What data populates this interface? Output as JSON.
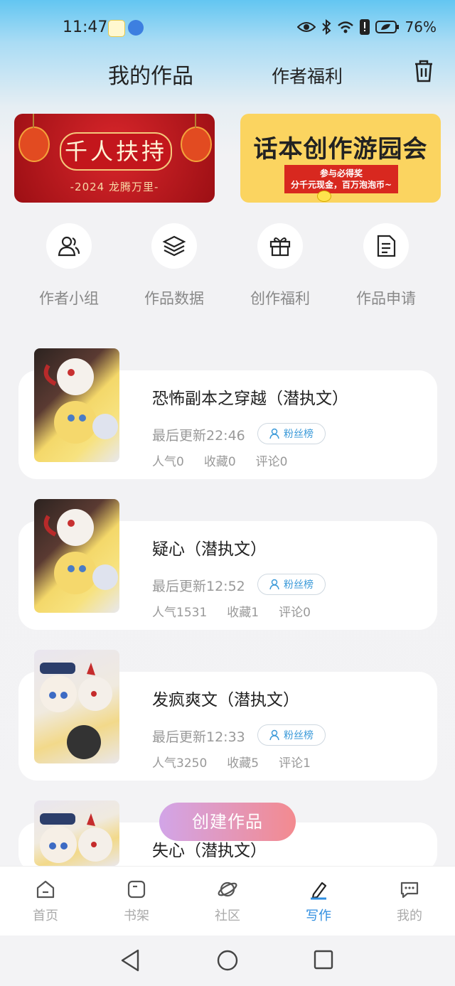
{
  "status_bar": {
    "time": "11:47",
    "battery": "76%",
    "icons": [
      "eye-icon",
      "bluetooth-icon",
      "wifi-icon",
      "alert-icon",
      "battery-icon"
    ]
  },
  "header": {
    "tab_works": "我的作品",
    "tab_welfare": "作者福利",
    "trash_icon": "trash-icon"
  },
  "banners": {
    "left": {
      "title": "千人扶持",
      "subtitle": "-2024 龙腾万里-"
    },
    "right": {
      "title": "话本创作游园会",
      "subtitle_line1": "参与必得奖",
      "subtitle_line2": "分千元现金，百万泡泡币~"
    }
  },
  "quick_nav": [
    {
      "label": "作者小组",
      "icon": "users-icon"
    },
    {
      "label": "作品数据",
      "icon": "layers-icon"
    },
    {
      "label": "创作福利",
      "icon": "gift-icon"
    },
    {
      "label": "作品申请",
      "icon": "document-icon"
    }
  ],
  "works": [
    {
      "title": "恐怖副本之穿越（潜执文）",
      "updated": "最后更新22:46",
      "fans_label": "粉丝榜",
      "popularity": "人气0",
      "favorites": "收藏0",
      "comments": "评论0"
    },
    {
      "title": "疑心（潜执文）",
      "updated": "最后更新12:52",
      "fans_label": "粉丝榜",
      "popularity": "人气1531",
      "favorites": "收藏1",
      "comments": "评论0"
    },
    {
      "title": "发疯爽文（潜执文）",
      "updated": "最后更新12:33",
      "fans_label": "粉丝榜",
      "popularity": "人气3250",
      "favorites": "收藏5",
      "comments": "评论1"
    },
    {
      "title": "失心（潜执文）"
    }
  ],
  "create_button": "创建作品",
  "tab_bar": [
    {
      "label": "首页",
      "icon": "home-icon"
    },
    {
      "label": "书架",
      "icon": "bookshelf-icon"
    },
    {
      "label": "社区",
      "icon": "planet-icon"
    },
    {
      "label": "写作",
      "icon": "pen-icon",
      "active": true
    },
    {
      "label": "我的",
      "icon": "chat-icon"
    }
  ],
  "colors": {
    "accent": "#2f8ee0",
    "create_start": "#d2a5e8",
    "create_end": "#f38a8f"
  }
}
